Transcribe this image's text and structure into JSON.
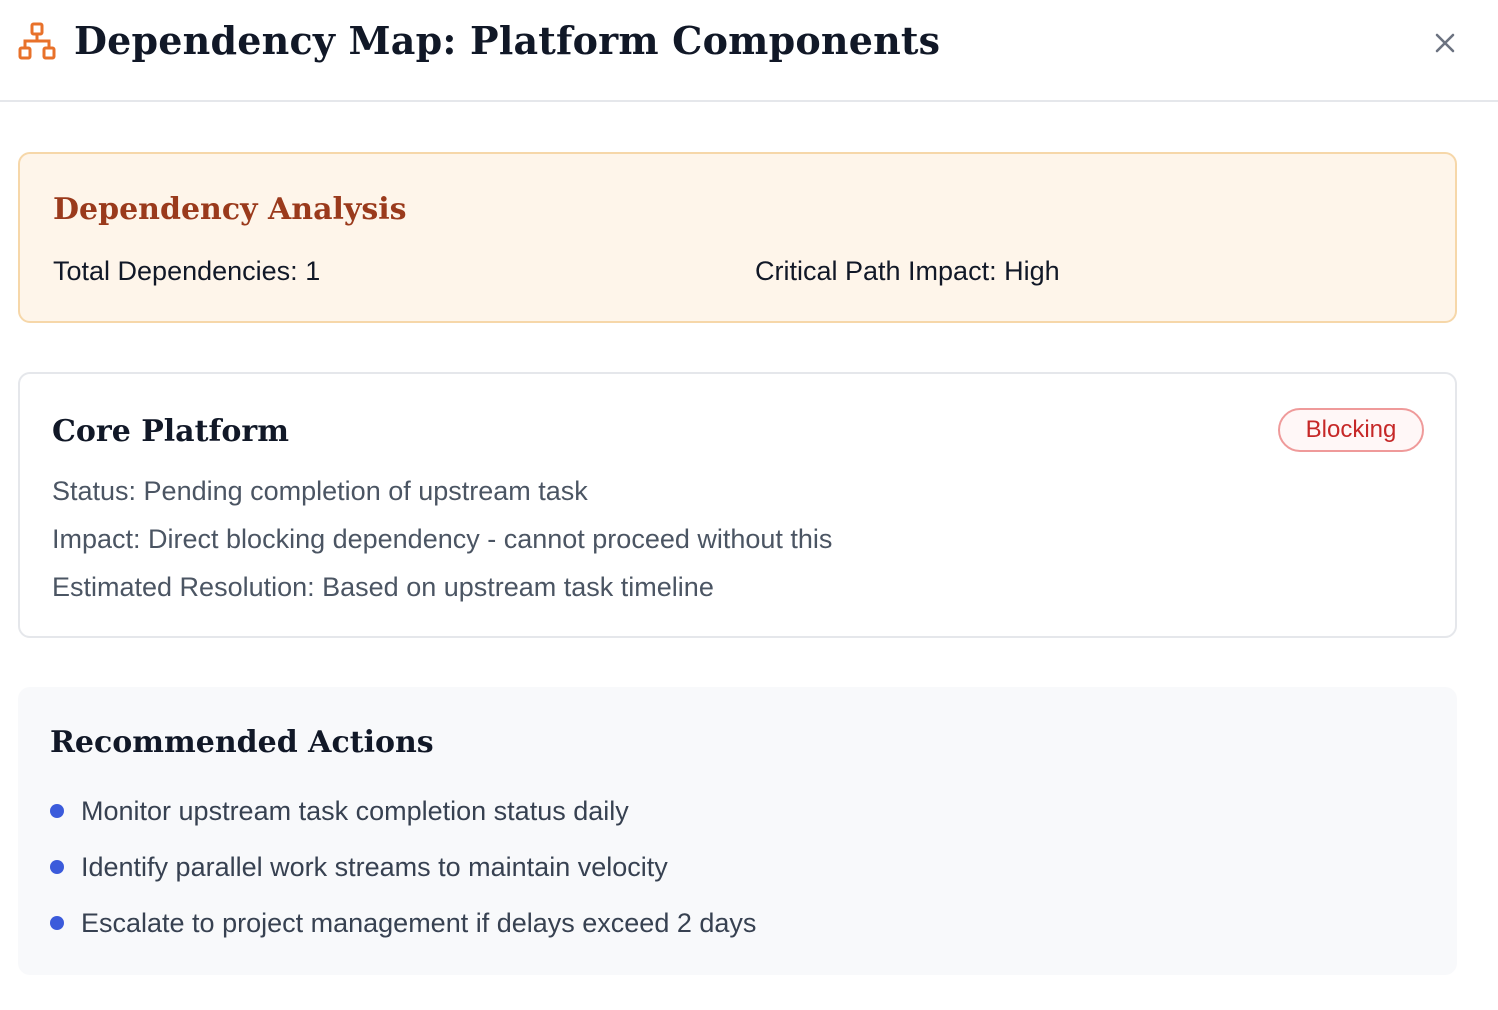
{
  "header": {
    "title": "Dependency Map: Platform Components",
    "icon": "sitemap-icon",
    "close_icon": "close-icon",
    "accent_color": "#e8712a"
  },
  "analysis": {
    "title": "Dependency Analysis",
    "total_label": "Total Dependencies:",
    "total_value": "1",
    "impact_label": "Critical Path Impact:",
    "impact_value": "High"
  },
  "dependency": {
    "name": "Core Platform",
    "badge": "Blocking",
    "status": "Status: Pending completion of upstream task",
    "impact": "Impact: Direct blocking dependency - cannot proceed without this",
    "resolution": "Estimated Resolution: Based on upstream task timeline"
  },
  "actions": {
    "title": "Recommended Actions",
    "items": [
      "Monitor upstream task completion status daily",
      "Identify parallel work streams to maintain velocity",
      "Escalate to project management if delays exceed 2 days"
    ],
    "bullet_color": "#3b5bdb"
  }
}
